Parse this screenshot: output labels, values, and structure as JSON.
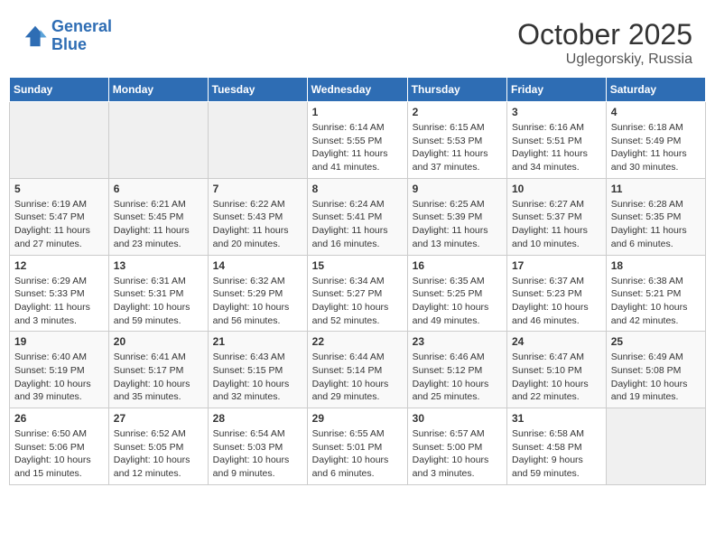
{
  "header": {
    "logo_line1": "General",
    "logo_line2": "Blue",
    "title": "October 2025",
    "subtitle": "Uglegorskiy, Russia"
  },
  "calendar": {
    "days_of_week": [
      "Sunday",
      "Monday",
      "Tuesday",
      "Wednesday",
      "Thursday",
      "Friday",
      "Saturday"
    ],
    "weeks": [
      [
        {
          "day": "",
          "info": ""
        },
        {
          "day": "",
          "info": ""
        },
        {
          "day": "",
          "info": ""
        },
        {
          "day": "1",
          "info": "Sunrise: 6:14 AM\nSunset: 5:55 PM\nDaylight: 11 hours and 41 minutes."
        },
        {
          "day": "2",
          "info": "Sunrise: 6:15 AM\nSunset: 5:53 PM\nDaylight: 11 hours and 37 minutes."
        },
        {
          "day": "3",
          "info": "Sunrise: 6:16 AM\nSunset: 5:51 PM\nDaylight: 11 hours and 34 minutes."
        },
        {
          "day": "4",
          "info": "Sunrise: 6:18 AM\nSunset: 5:49 PM\nDaylight: 11 hours and 30 minutes."
        }
      ],
      [
        {
          "day": "5",
          "info": "Sunrise: 6:19 AM\nSunset: 5:47 PM\nDaylight: 11 hours and 27 minutes."
        },
        {
          "day": "6",
          "info": "Sunrise: 6:21 AM\nSunset: 5:45 PM\nDaylight: 11 hours and 23 minutes."
        },
        {
          "day": "7",
          "info": "Sunrise: 6:22 AM\nSunset: 5:43 PM\nDaylight: 11 hours and 20 minutes."
        },
        {
          "day": "8",
          "info": "Sunrise: 6:24 AM\nSunset: 5:41 PM\nDaylight: 11 hours and 16 minutes."
        },
        {
          "day": "9",
          "info": "Sunrise: 6:25 AM\nSunset: 5:39 PM\nDaylight: 11 hours and 13 minutes."
        },
        {
          "day": "10",
          "info": "Sunrise: 6:27 AM\nSunset: 5:37 PM\nDaylight: 11 hours and 10 minutes."
        },
        {
          "day": "11",
          "info": "Sunrise: 6:28 AM\nSunset: 5:35 PM\nDaylight: 11 hours and 6 minutes."
        }
      ],
      [
        {
          "day": "12",
          "info": "Sunrise: 6:29 AM\nSunset: 5:33 PM\nDaylight: 11 hours and 3 minutes."
        },
        {
          "day": "13",
          "info": "Sunrise: 6:31 AM\nSunset: 5:31 PM\nDaylight: 10 hours and 59 minutes."
        },
        {
          "day": "14",
          "info": "Sunrise: 6:32 AM\nSunset: 5:29 PM\nDaylight: 10 hours and 56 minutes."
        },
        {
          "day": "15",
          "info": "Sunrise: 6:34 AM\nSunset: 5:27 PM\nDaylight: 10 hours and 52 minutes."
        },
        {
          "day": "16",
          "info": "Sunrise: 6:35 AM\nSunset: 5:25 PM\nDaylight: 10 hours and 49 minutes."
        },
        {
          "day": "17",
          "info": "Sunrise: 6:37 AM\nSunset: 5:23 PM\nDaylight: 10 hours and 46 minutes."
        },
        {
          "day": "18",
          "info": "Sunrise: 6:38 AM\nSunset: 5:21 PM\nDaylight: 10 hours and 42 minutes."
        }
      ],
      [
        {
          "day": "19",
          "info": "Sunrise: 6:40 AM\nSunset: 5:19 PM\nDaylight: 10 hours and 39 minutes."
        },
        {
          "day": "20",
          "info": "Sunrise: 6:41 AM\nSunset: 5:17 PM\nDaylight: 10 hours and 35 minutes."
        },
        {
          "day": "21",
          "info": "Sunrise: 6:43 AM\nSunset: 5:15 PM\nDaylight: 10 hours and 32 minutes."
        },
        {
          "day": "22",
          "info": "Sunrise: 6:44 AM\nSunset: 5:14 PM\nDaylight: 10 hours and 29 minutes."
        },
        {
          "day": "23",
          "info": "Sunrise: 6:46 AM\nSunset: 5:12 PM\nDaylight: 10 hours and 25 minutes."
        },
        {
          "day": "24",
          "info": "Sunrise: 6:47 AM\nSunset: 5:10 PM\nDaylight: 10 hours and 22 minutes."
        },
        {
          "day": "25",
          "info": "Sunrise: 6:49 AM\nSunset: 5:08 PM\nDaylight: 10 hours and 19 minutes."
        }
      ],
      [
        {
          "day": "26",
          "info": "Sunrise: 6:50 AM\nSunset: 5:06 PM\nDaylight: 10 hours and 15 minutes."
        },
        {
          "day": "27",
          "info": "Sunrise: 6:52 AM\nSunset: 5:05 PM\nDaylight: 10 hours and 12 minutes."
        },
        {
          "day": "28",
          "info": "Sunrise: 6:54 AM\nSunset: 5:03 PM\nDaylight: 10 hours and 9 minutes."
        },
        {
          "day": "29",
          "info": "Sunrise: 6:55 AM\nSunset: 5:01 PM\nDaylight: 10 hours and 6 minutes."
        },
        {
          "day": "30",
          "info": "Sunrise: 6:57 AM\nSunset: 5:00 PM\nDaylight: 10 hours and 3 minutes."
        },
        {
          "day": "31",
          "info": "Sunrise: 6:58 AM\nSunset: 4:58 PM\nDaylight: 9 hours and 59 minutes."
        },
        {
          "day": "",
          "info": ""
        }
      ]
    ]
  }
}
